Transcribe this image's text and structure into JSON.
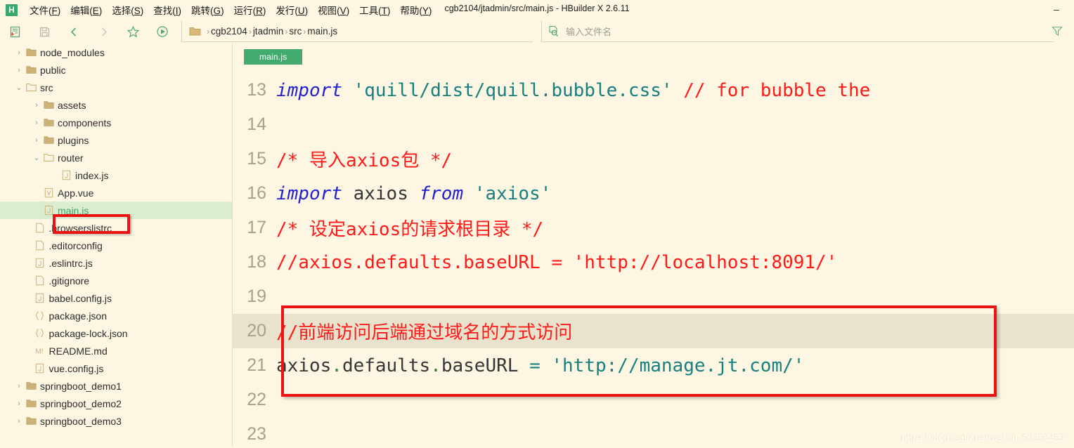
{
  "window": {
    "title": "cgb2104/jtadmin/src/main.js - HBuilder X 2.6.11",
    "logo": "H",
    "minimize": "–"
  },
  "menubar": {
    "items": [
      {
        "label": "文件(F)",
        "text": "文件",
        "mnemonic": "F"
      },
      {
        "label": "编辑(E)",
        "text": "编辑",
        "mnemonic": "E"
      },
      {
        "label": "选择(S)",
        "text": "选择",
        "mnemonic": "S"
      },
      {
        "label": "查找(I)",
        "text": "查找",
        "mnemonic": "I"
      },
      {
        "label": "跳转(G)",
        "text": "跳转",
        "mnemonic": "G"
      },
      {
        "label": "运行(R)",
        "text": "运行",
        "mnemonic": "R"
      },
      {
        "label": "发行(U)",
        "text": "发行",
        "mnemonic": "U"
      },
      {
        "label": "视图(V)",
        "text": "视图",
        "mnemonic": "V"
      },
      {
        "label": "工具(T)",
        "text": "工具",
        "mnemonic": "T"
      },
      {
        "label": "帮助(Y)",
        "text": "帮助",
        "mnemonic": "Y"
      }
    ]
  },
  "toolbar": {
    "buttons": [
      {
        "icon": "new-file-icon"
      },
      {
        "icon": "save-icon"
      },
      {
        "icon": "back-arrow-icon"
      },
      {
        "icon": "forward-arrow-icon"
      },
      {
        "icon": "star-icon"
      },
      {
        "icon": "run-icon"
      }
    ]
  },
  "breadcrumb": {
    "folder_icon": "folder-icon",
    "segments": [
      "cgb2104",
      "jtadmin",
      "src",
      "main.js"
    ],
    "separator": "›"
  },
  "search": {
    "icon": "file-search-icon",
    "placeholder": "输入文件名",
    "filter_icon": "filter-icon"
  },
  "sidebar": {
    "items": [
      {
        "label": "node_modules",
        "type": "folder",
        "twisty": "›",
        "depth": 1,
        "selected": false
      },
      {
        "label": "public",
        "type": "folder",
        "twisty": "›",
        "depth": 1,
        "selected": false
      },
      {
        "label": "src",
        "type": "folder-open",
        "twisty": "⌄",
        "depth": 1,
        "selected": false
      },
      {
        "label": "assets",
        "type": "folder",
        "twisty": "›",
        "depth": 2,
        "selected": false
      },
      {
        "label": "components",
        "type": "folder",
        "twisty": "›",
        "depth": 2,
        "selected": false
      },
      {
        "label": "plugins",
        "type": "folder",
        "twisty": "›",
        "depth": 2,
        "selected": false
      },
      {
        "label": "router",
        "type": "folder-open",
        "twisty": "⌄",
        "depth": 2,
        "selected": false
      },
      {
        "label": "index.js",
        "type": "js",
        "twisty": "",
        "depth": 3,
        "selected": false
      },
      {
        "label": "App.vue",
        "type": "vue",
        "twisty": "",
        "depth": 2,
        "selected": false
      },
      {
        "label": "main.js",
        "type": "js",
        "twisty": "",
        "depth": 2,
        "selected": true
      },
      {
        "label": ".browserslistrc",
        "type": "plain",
        "twisty": "",
        "depth": 1.5,
        "selected": false
      },
      {
        "label": ".editorconfig",
        "type": "plain",
        "twisty": "",
        "depth": 1.5,
        "selected": false
      },
      {
        "label": ".eslintrc.js",
        "type": "js",
        "twisty": "",
        "depth": 1.5,
        "selected": false
      },
      {
        "label": ".gitignore",
        "type": "plain",
        "twisty": "",
        "depth": 1.5,
        "selected": false
      },
      {
        "label": "babel.config.js",
        "type": "js",
        "twisty": "",
        "depth": 1.5,
        "selected": false
      },
      {
        "label": "package.json",
        "type": "json",
        "twisty": "",
        "depth": 1.5,
        "selected": false
      },
      {
        "label": "package-lock.json",
        "type": "json",
        "twisty": "",
        "depth": 1.5,
        "selected": false
      },
      {
        "label": "README.md",
        "type": "md",
        "twisty": "",
        "depth": 1.5,
        "selected": false
      },
      {
        "label": "vue.config.js",
        "type": "js",
        "twisty": "",
        "depth": 1.5,
        "selected": false
      },
      {
        "label": "springboot_demo1",
        "type": "folder",
        "twisty": "›",
        "depth": 1,
        "selected": false
      },
      {
        "label": "springboot_demo2",
        "type": "folder",
        "twisty": "›",
        "depth": 1,
        "selected": false
      },
      {
        "label": "springboot_demo3",
        "type": "folder",
        "twisty": "›",
        "depth": 1,
        "selected": false
      }
    ]
  },
  "editor": {
    "tabs": [
      {
        "label": "main.js",
        "active": true
      }
    ],
    "lines": [
      {
        "number": "13",
        "current": false,
        "tokens": [
          {
            "t": "import",
            "c": "t-kw"
          },
          {
            "t": " ",
            "c": "t-plain"
          },
          {
            "t": "'quill/dist/quill.bubble.css'",
            "c": "t-str"
          },
          {
            "t": " ",
            "c": "t-plain"
          },
          {
            "t": "// for bubble the",
            "c": "t-cmt"
          }
        ]
      },
      {
        "number": "14",
        "current": false,
        "tokens": []
      },
      {
        "number": "15",
        "current": false,
        "tokens": [
          {
            "t": "/* 导入axios包 */",
            "c": "t-cmt"
          }
        ]
      },
      {
        "number": "16",
        "current": false,
        "tokens": [
          {
            "t": "import",
            "c": "t-kw"
          },
          {
            "t": " axios ",
            "c": "t-plain"
          },
          {
            "t": "from",
            "c": "t-kw"
          },
          {
            "t": " ",
            "c": "t-plain"
          },
          {
            "t": "'axios'",
            "c": "t-str"
          }
        ]
      },
      {
        "number": "17",
        "current": false,
        "tokens": [
          {
            "t": "/* 设定axios的请求根目录 */",
            "c": "t-cmt"
          }
        ]
      },
      {
        "number": "18",
        "current": false,
        "tokens": [
          {
            "t": "//axios.defaults.baseURL = 'http://localhost:8091/'",
            "c": "t-cmt"
          }
        ]
      },
      {
        "number": "19",
        "current": false,
        "tokens": []
      },
      {
        "number": "20",
        "current": true,
        "tokens": [
          {
            "t": "//前端访问后端通过域名的方式访问",
            "c": "t-cmt"
          }
        ]
      },
      {
        "number": "21",
        "current": false,
        "tokens": [
          {
            "t": "axios",
            "c": "t-plain"
          },
          {
            "t": ".",
            "c": "t-dot"
          },
          {
            "t": "defaults",
            "c": "t-plain"
          },
          {
            "t": ".",
            "c": "t-dot"
          },
          {
            "t": "baseURL",
            "c": "t-plain"
          },
          {
            "t": " ",
            "c": "t-plain"
          },
          {
            "t": "=",
            "c": "t-eq"
          },
          {
            "t": " ",
            "c": "t-plain"
          },
          {
            "t": "'http://manage.jt.com/'",
            "c": "t-str"
          }
        ]
      },
      {
        "number": "22",
        "current": false,
        "tokens": []
      },
      {
        "number": "23",
        "current": false,
        "tokens": []
      }
    ]
  },
  "annotations": [
    {
      "name": "main-js-highlight-box",
      "color": "#ee1111"
    },
    {
      "name": "code-highlight-box",
      "color": "#ee1111"
    }
  ],
  "watermark": {
    "text": "https://blog.csdn.net/weixin_50650453"
  }
}
